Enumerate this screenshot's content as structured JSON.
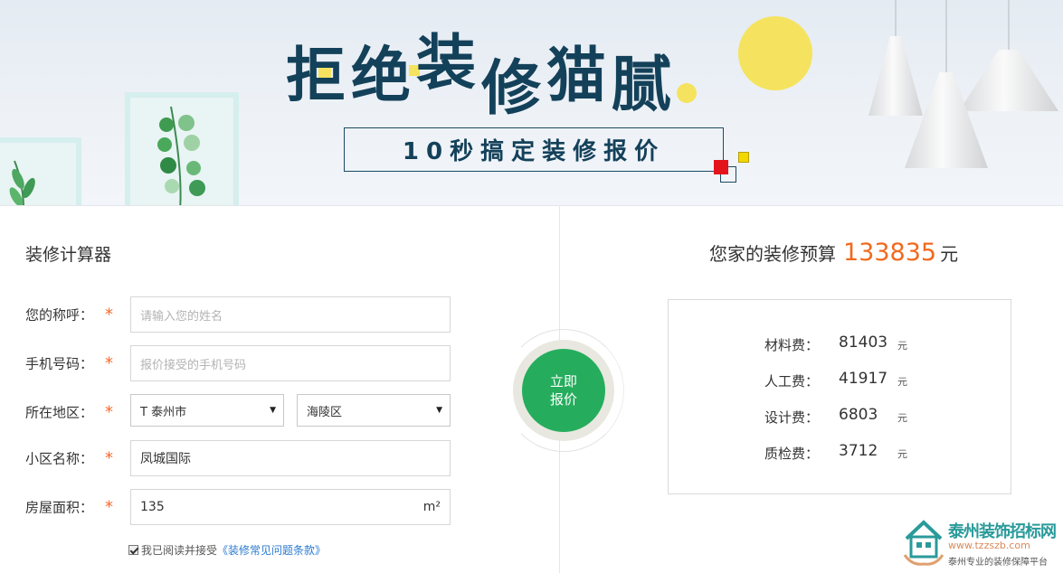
{
  "banner": {
    "headline_chars": [
      "拒",
      "绝",
      "装",
      "修",
      "猫",
      "腻"
    ],
    "subtitle": "10秒搞定装修报价"
  },
  "form": {
    "title": "装修计算器",
    "required_mark": "*",
    "name": {
      "label": "您的称呼：",
      "placeholder": "请输入您的姓名"
    },
    "phone": {
      "label": "手机号码：",
      "placeholder": "报价接受的手机号码"
    },
    "region": {
      "label": "所在地区：",
      "city": "T 泰州市",
      "district": "海陵区"
    },
    "community": {
      "label": "小区名称：",
      "value": "凤城国际"
    },
    "area": {
      "label": "房屋面积：",
      "value": "135",
      "unit": "m²"
    },
    "agreement": {
      "text": "我已阅读并接受",
      "link": "《装修常见问题条款》",
      "checked": true
    }
  },
  "action": {
    "line1": "立即",
    "line2": "报价"
  },
  "result": {
    "prefix": "您家的装修预算",
    "total": "133835",
    "suffix": "元",
    "fees": [
      {
        "label": "材料费：",
        "value": "81403",
        "unit": "元"
      },
      {
        "label": "人工费：",
        "value": "41917",
        "unit": "元"
      },
      {
        "label": "设计费：",
        "value": "6803",
        "unit": "元"
      },
      {
        "label": "质检费：",
        "value": "3712",
        "unit": "元"
      }
    ]
  },
  "watermark": {
    "name": "泰州装饰招标网",
    "url": "www.tzzszb.com",
    "slogan": "泰州专业的装修保障平台"
  },
  "colors": {
    "accent_orange": "#f06a1f",
    "button_green": "#25ad5d",
    "headline_navy": "#14415a",
    "link_blue": "#2a7ad0",
    "required_star": "#f26a2b"
  }
}
